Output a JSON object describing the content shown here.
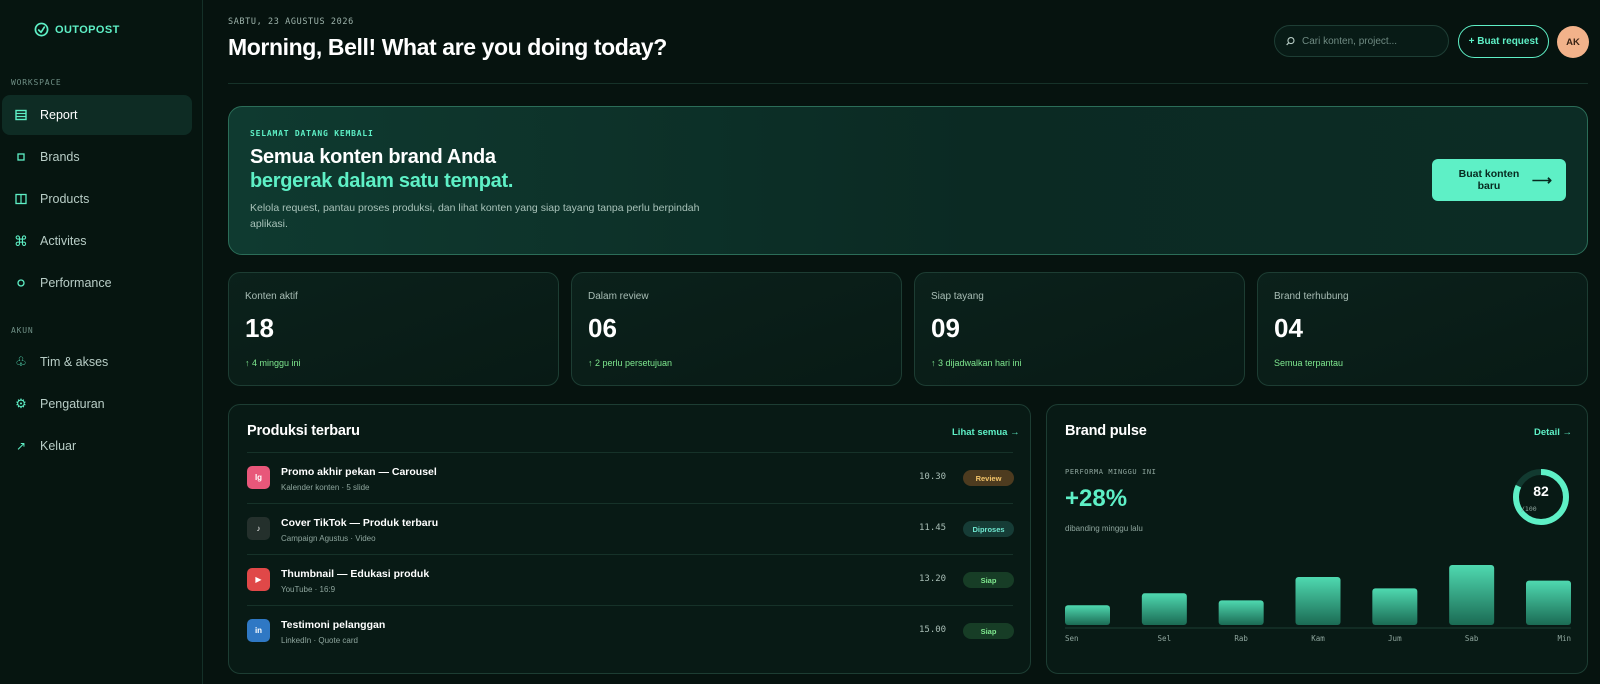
{
  "app": {
    "logo_text": "OUTOPOST"
  },
  "sidebar": {
    "sections": [
      {
        "label": "WORKSPACE"
      },
      {
        "label": "AKUN"
      }
    ],
    "items": [
      {
        "label": "Report",
        "icon": "table-icon",
        "active": true
      },
      {
        "label": "Brands",
        "icon": "square-icon"
      },
      {
        "label": "Products",
        "icon": "columns-icon"
      },
      {
        "label": "Activites",
        "icon": "command-icon"
      },
      {
        "label": "Performance",
        "icon": "circle-icon"
      },
      {
        "label": "Tim & akses",
        "icon": "club-icon"
      },
      {
        "label": "Pengaturan",
        "icon": "gear-icon"
      },
      {
        "label": "Keluar",
        "icon": "arrow-out-icon"
      }
    ]
  },
  "header": {
    "date": "SABTU, 23 AGUSTUS 2026",
    "greeting": "Morning, Bell! What are you doing today?",
    "search_placeholder": "Cari konten, project...",
    "request_button": "+ Buat request",
    "avatar_initials": "AK"
  },
  "hero": {
    "kicker": "SELAMAT DATANG KEMBALI",
    "title": "Semua konten brand Anda",
    "title_accent": "bergerak dalam satu tempat.",
    "description": "Kelola request, pantau proses produksi, dan lihat konten yang siap tayang tanpa perlu berpindah aplikasi.",
    "cta": "Buat konten baru",
    "cta_arrow": "⟶"
  },
  "stats": [
    {
      "label": "Konten aktif",
      "value": "18",
      "note": "↑ 4 minggu ini"
    },
    {
      "label": "Dalam review",
      "value": "06",
      "note": "↑ 2 perlu persetujuan"
    },
    {
      "label": "Siap tayang",
      "value": "09",
      "note": "↑ 3 dijadwalkan hari ini"
    },
    {
      "label": "Brand terhubung",
      "value": "04",
      "note": "Semua terpantau"
    }
  ],
  "production": {
    "title": "Produksi terbaru",
    "link": "Lihat semua →",
    "rows": [
      {
        "icon_text": "Ig",
        "icon": "instagram-icon",
        "color": "#e8577a",
        "title": "Promo akhir pekan — Carousel",
        "sub": "Kalender konten · 5 slide",
        "time": "10.30",
        "status": "Review",
        "status_bg": "#4d3b1f",
        "status_fg": "#f2c46a"
      },
      {
        "icon_text": "♪",
        "icon": "tiktok-icon",
        "color": "#24302c",
        "title": "Cover TikTok — Produk terbaru",
        "sub": "Campaign Agustus · Video",
        "time": "11.45",
        "status": "Diproses",
        "status_bg": "#163c36",
        "status_fg": "#6fe6cf"
      },
      {
        "icon_text": "▶",
        "icon": "youtube-icon",
        "color": "#e04848",
        "title": "Thumbnail — Edukasi produk",
        "sub": "YouTube · 16:9",
        "time": "13.20",
        "status": "Siap",
        "status_bg": "#173d26",
        "status_fg": "#7fe88f"
      },
      {
        "icon_text": "in",
        "icon": "linkedin-icon",
        "color": "#2f78c4",
        "title": "Testimoni pelanggan",
        "sub": "LinkedIn · Quote card",
        "time": "15.00",
        "status": "Siap",
        "status_bg": "#173d26",
        "status_fg": "#7fe88f"
      }
    ]
  },
  "pulse": {
    "title": "Brand pulse",
    "link": "Detail →",
    "kicker": "PERFORMA MINGGU INI",
    "value": "+28%",
    "note": "dibanding minggu lalu",
    "score": "82",
    "score_max": "/100",
    "score_fraction": 0.82
  },
  "chart_data": {
    "type": "bar",
    "categories": [
      "Sen",
      "Sel",
      "Rab",
      "Kam",
      "Jum",
      "Sab",
      "Min"
    ],
    "values": [
      33,
      53,
      41,
      80,
      61,
      100,
      74
    ],
    "ylim": [
      0,
      100
    ],
    "bar_color_top": "#4fd9b0",
    "bar_color_bottom": "#1b6b54",
    "grid": false
  },
  "colors": {
    "accent": "#5ef0c6",
    "background": "#06130f",
    "positive": "#7fe88f"
  }
}
